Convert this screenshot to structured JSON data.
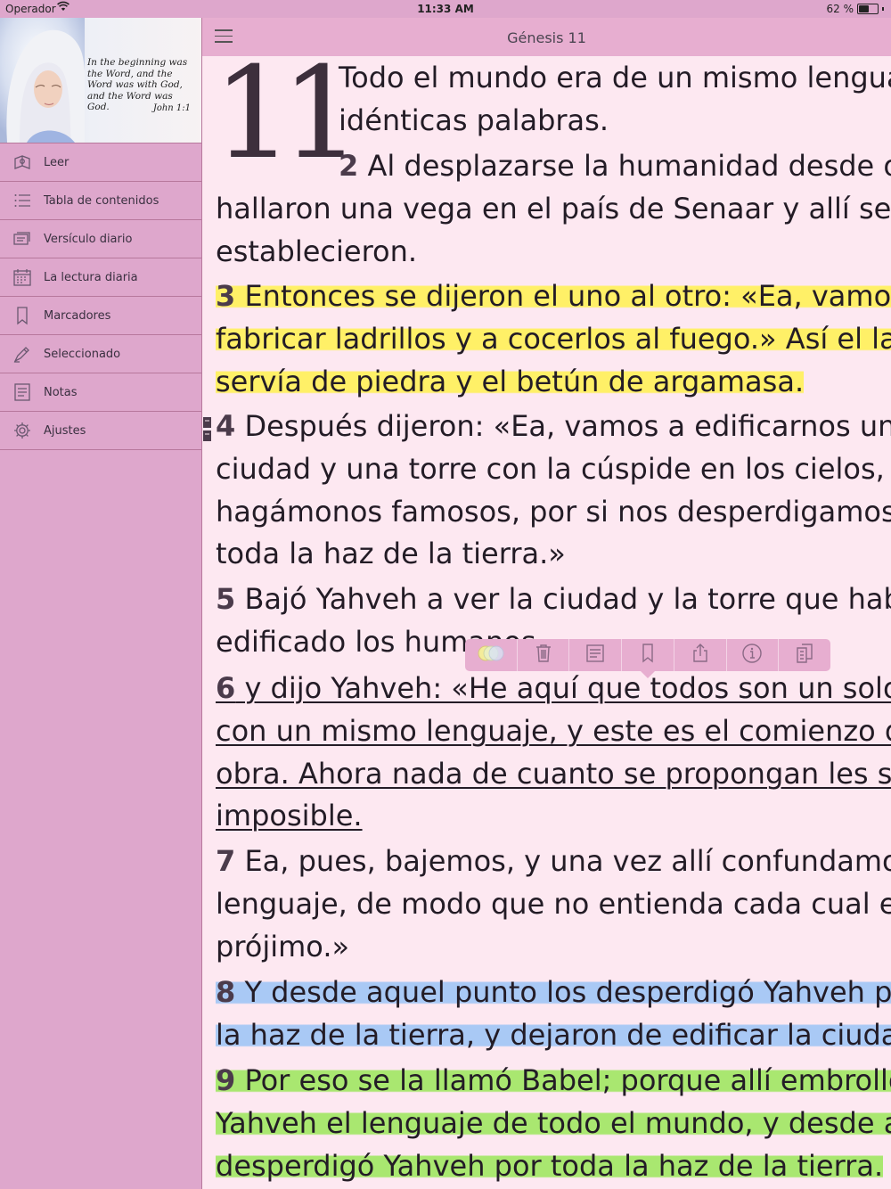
{
  "status_bar": {
    "carrier": "Operador",
    "time": "11:33 AM",
    "battery_percent": "62 %",
    "battery_level": 0.62
  },
  "sidebar": {
    "banner": {
      "quote": "In the beginning was the Word, and the Word was with God, and the Word was God.",
      "reference": "John 1:1"
    },
    "items": [
      {
        "label": "Leer",
        "icon": "read-icon"
      },
      {
        "label": "Tabla de contenidos",
        "icon": "list-icon"
      },
      {
        "label": "Versículo diario",
        "icon": "daily-verse-icon"
      },
      {
        "label": "La lectura diaria",
        "icon": "calendar-icon"
      },
      {
        "label": "Marcadores",
        "icon": "bookmark-icon"
      },
      {
        "label": "Seleccionado",
        "icon": "highlighter-icon"
      },
      {
        "label": "Notas",
        "icon": "notes-icon"
      },
      {
        "label": "Ajustes",
        "icon": "gear-icon"
      }
    ]
  },
  "header": {
    "title": "Génesis 11"
  },
  "reader": {
    "chapter_number": "11",
    "highlight_colors": {
      "yellow": "#fff067",
      "blue": "#a9c9f5",
      "green": "#a9e770"
    },
    "lines": [
      {
        "num": "",
        "text": "Todo el mundo era de un mismo lenguaje e",
        "style": "plain",
        "indent": true
      },
      {
        "num": "",
        "text": "idénticas palabras.",
        "style": "plain",
        "indent": true
      },
      {
        "num": "2",
        "text": " Al desplazarse la humanidad desde oriente,",
        "style": "plain",
        "indent": true
      },
      {
        "num": "",
        "text": "hallaron una vega en el país de Senaar y allí se",
        "style": "plain",
        "indent": false
      },
      {
        "num": "",
        "text": "establecieron.",
        "style": "plain",
        "indent": false
      },
      {
        "num": "3",
        "text": " Entonces se dijeron el uno al otro: «Ea, vamos a",
        "style": "yellow",
        "indent": false
      },
      {
        "num": "",
        "text": "fabricar ladrillos y a cocerlos al fuego.» Así el ladrillo les",
        "style": "yellow",
        "indent": false
      },
      {
        "num": "",
        "text": "servía de piedra y el betún de argamasa.",
        "style": "yellow",
        "indent": false
      },
      {
        "num": "4",
        "text": " Después dijeron: «Ea, vamos a edificarnos una",
        "style": "plain",
        "indent": false
      },
      {
        "num": "",
        "text": "ciudad y una torre con la cúspide en los cielos, y",
        "style": "plain",
        "indent": false
      },
      {
        "num": "",
        "text": "hagámonos famosos, por si nos desperdigamos por",
        "style": "plain",
        "indent": false
      },
      {
        "num": "",
        "text": "toda la haz de la tierra.»",
        "style": "plain",
        "indent": false
      },
      {
        "num": "5",
        "text": " Bajó Yahveh a ver la ciudad y la torre que habían",
        "style": "plain",
        "indent": false
      },
      {
        "num": "",
        "text": "edificado los humanos,",
        "style": "plain",
        "indent": false
      },
      {
        "num": "6",
        "text": " y dijo Yahveh: «He aquí que todos son un solo pueblo",
        "style": "underline",
        "indent": false
      },
      {
        "num": "",
        "text": "con un mismo lenguaje, y este es el comienzo de su",
        "style": "underline",
        "indent": false
      },
      {
        "num": "",
        "text": "obra. Ahora nada de cuanto se propongan les será",
        "style": "underline",
        "indent": false
      },
      {
        "num": "",
        "text": "imposible.",
        "style": "underline",
        "indent": false
      },
      {
        "num": "7",
        "text": " Ea, pues, bajemos, y una vez allí confundamos su",
        "style": "plain",
        "indent": false
      },
      {
        "num": "",
        "text": "lenguaje, de modo que no entienda cada cual el de su",
        "style": "plain",
        "indent": false
      },
      {
        "num": "",
        "text": "prójimo.»",
        "style": "plain",
        "indent": false
      },
      {
        "num": "8",
        "text": " Y desde aquel punto los desperdigó Yahveh por toda",
        "style": "blue",
        "indent": false
      },
      {
        "num": "",
        "text": "la haz de la tierra, y dejaron de edificar la ciudad.",
        "style": "blue",
        "indent": false
      },
      {
        "num": "9",
        "text": " Por eso se la llamó Babel; porque allí embrolló",
        "style": "green",
        "indent": false
      },
      {
        "num": "",
        "text": "Yahveh el lenguaje de todo el mundo, y desde allí los",
        "style": "green",
        "indent": false
      },
      {
        "num": "",
        "text": "desperdigó Yahveh por toda la haz de la tierra.",
        "style": "green",
        "indent": false
      }
    ]
  },
  "selection_toolbar": {
    "buttons": [
      {
        "name": "color-picker-button",
        "icon": "color-circles-icon"
      },
      {
        "name": "delete-button",
        "icon": "trash-icon"
      },
      {
        "name": "note-button",
        "icon": "note-icon"
      },
      {
        "name": "bookmark-button",
        "icon": "bookmark-icon"
      },
      {
        "name": "share-button",
        "icon": "share-icon"
      },
      {
        "name": "info-button",
        "icon": "info-icon"
      },
      {
        "name": "copy-button",
        "icon": "copy-icon"
      }
    ]
  }
}
